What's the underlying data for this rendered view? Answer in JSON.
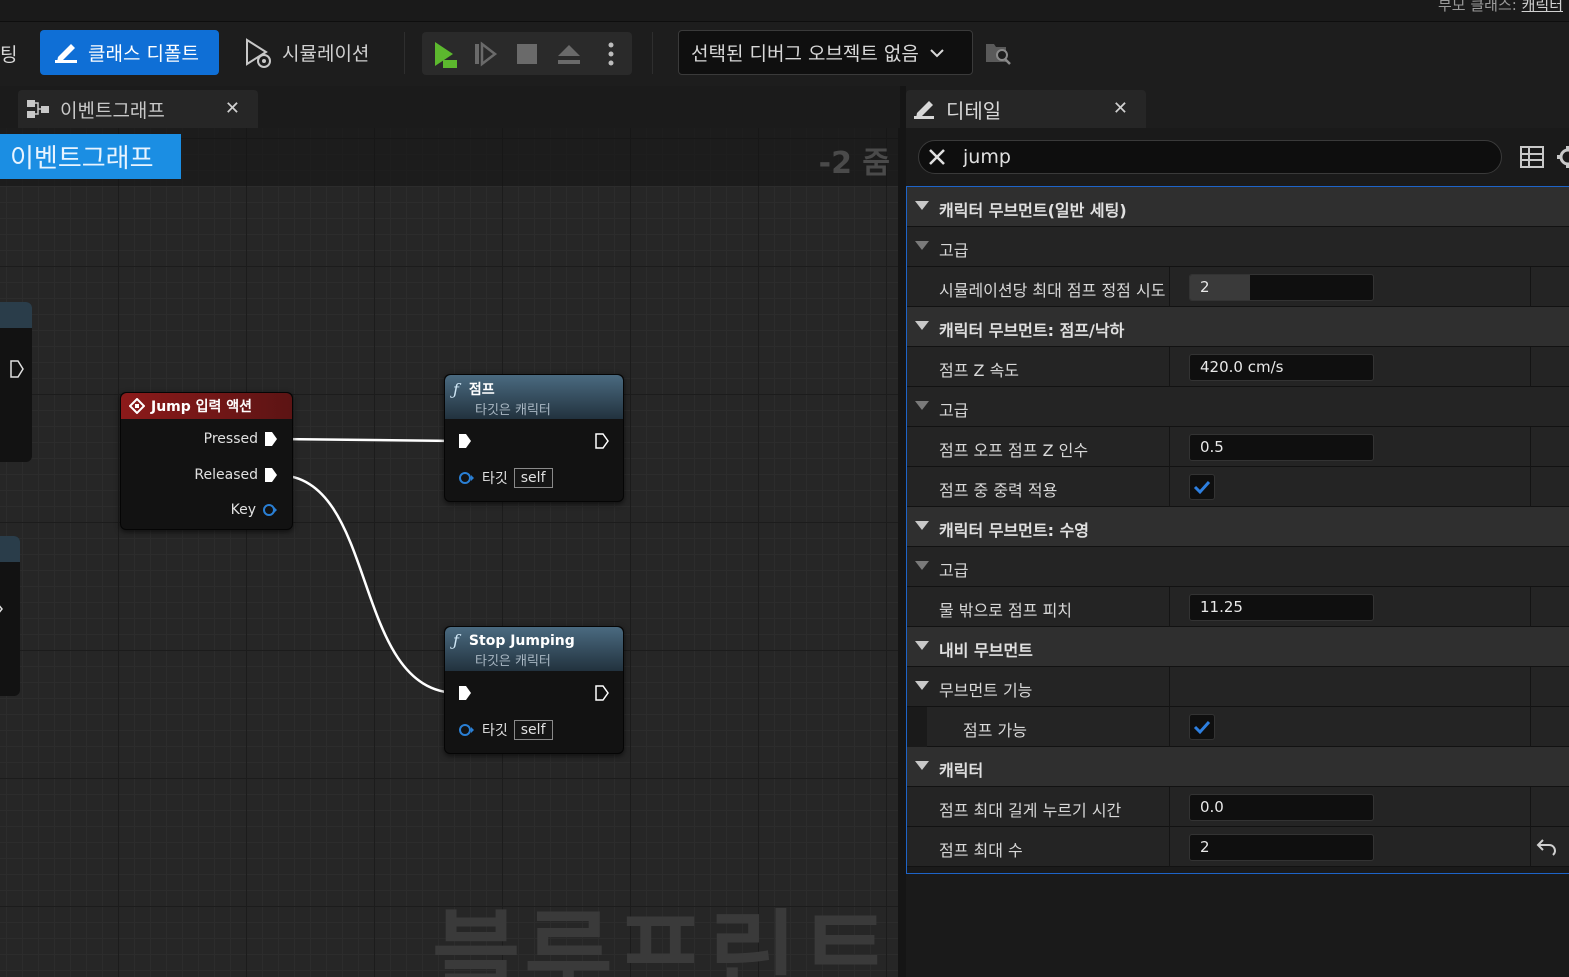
{
  "topbar": {
    "parent_label": "부모 클래스:",
    "parent_link": "캐릭터"
  },
  "toolbar": {
    "cut_label": "팅",
    "class_defaults_label": "클래스 디폴트",
    "simulation_label": "시뮬레이션",
    "debug_object_label": "선택된 디버그 오브젝트 없음",
    "play_icons": [
      "play-icon",
      "step-icon",
      "stop-icon",
      "eject-icon",
      "more-icon"
    ]
  },
  "graph_tab": {
    "label": "이벤트그래프"
  },
  "graph": {
    "breadcrumb": "이벤트그래프",
    "zoom": "-2 줌",
    "watermark": "블루프린트"
  },
  "nodes": {
    "input_action": {
      "title": "Jump 입력 액션",
      "pins": [
        "Pressed",
        "Released",
        "Key"
      ],
      "header_color": "#8c1a1a"
    },
    "jump": {
      "title": "점프",
      "subtitle": "타깃은 캐릭터",
      "target_label": "타깃",
      "target_value": "self"
    },
    "stop_jumping": {
      "title": "Stop Jumping",
      "subtitle": "타깃은 캐릭터",
      "target_label": "타깃",
      "target_value": "self"
    }
  },
  "details": {
    "tab_label": "디테일",
    "search_value": "jump",
    "rows": [
      {
        "kind": "cat",
        "label": "캐릭터 무브먼트(일반 세팅)"
      },
      {
        "kind": "sub",
        "label": "고급"
      },
      {
        "kind": "prop",
        "label": "시뮬레이션당 최대 점프 정점 시도",
        "value": "2",
        "fill": 0.33
      },
      {
        "kind": "cat",
        "label": "캐릭터 무브먼트: 점프/낙하"
      },
      {
        "kind": "prop",
        "label": "점프 Z 속도",
        "value": "420.0 cm/s"
      },
      {
        "kind": "sub",
        "label": "고급"
      },
      {
        "kind": "prop",
        "label": "점프 오프 점프 Z 인수",
        "value": "0.5"
      },
      {
        "kind": "check",
        "label": "점프 중 중력 적용",
        "checked": true
      },
      {
        "kind": "cat",
        "label": "캐릭터 무브먼트: 수영"
      },
      {
        "kind": "sub",
        "label": "고급"
      },
      {
        "kind": "prop",
        "label": "물 밖으로 점프 피치",
        "value": "11.25"
      },
      {
        "kind": "cat",
        "label": "내비 무브먼트"
      },
      {
        "kind": "cat2",
        "label": "무브먼트 기능"
      },
      {
        "kind": "check-indent",
        "label": "점프 가능",
        "checked": true
      },
      {
        "kind": "cat",
        "label": "캐릭터"
      },
      {
        "kind": "prop",
        "label": "점프 최대 길게 누르기 시간",
        "value": "0.0"
      },
      {
        "kind": "prop-reset",
        "label": "점프 최대 수",
        "value": "2"
      }
    ]
  },
  "colors": {
    "accent": "#0f6fd6",
    "breadcrumb": "#1b8ee3",
    "check": "#2d7fe0",
    "exec_wire": "#ffffff",
    "object_pin": "#2a7fd4"
  }
}
